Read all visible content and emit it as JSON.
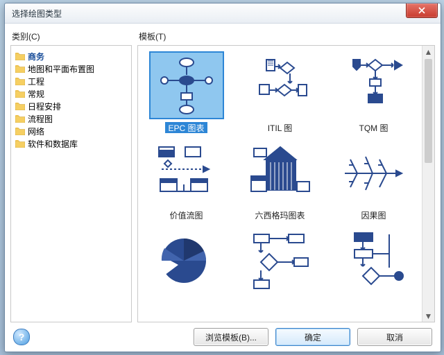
{
  "window": {
    "title": "选择绘图类型"
  },
  "labels": {
    "categories": "类别(C)",
    "templates": "模板(T)"
  },
  "categories": {
    "items": [
      {
        "label": "商务",
        "selected": true
      },
      {
        "label": "地图和平面布置图",
        "selected": false
      },
      {
        "label": "工程",
        "selected": false
      },
      {
        "label": "常规",
        "selected": false
      },
      {
        "label": "日程安排",
        "selected": false
      },
      {
        "label": "流程图",
        "selected": false
      },
      {
        "label": "网络",
        "selected": false
      },
      {
        "label": "软件和数据库",
        "selected": false
      }
    ]
  },
  "templates": {
    "items": [
      {
        "label": "EPC 图表",
        "selected": true
      },
      {
        "label": "ITIL 图",
        "selected": false
      },
      {
        "label": "TQM 图",
        "selected": false
      },
      {
        "label": "价值流图",
        "selected": false
      },
      {
        "label": "六西格玛图表",
        "selected": false
      },
      {
        "label": "因果图",
        "selected": false
      },
      {
        "label": "",
        "selected": false
      },
      {
        "label": "",
        "selected": false
      },
      {
        "label": "",
        "selected": false
      }
    ]
  },
  "buttons": {
    "browse": "浏览模板(B)...",
    "ok": "确定",
    "cancel": "取消"
  },
  "icons": {
    "help": "?",
    "close": "close-icon"
  },
  "colors": {
    "accent": "#2d86d6",
    "shape": "#2a4a8f",
    "close": "#c83b2e"
  }
}
